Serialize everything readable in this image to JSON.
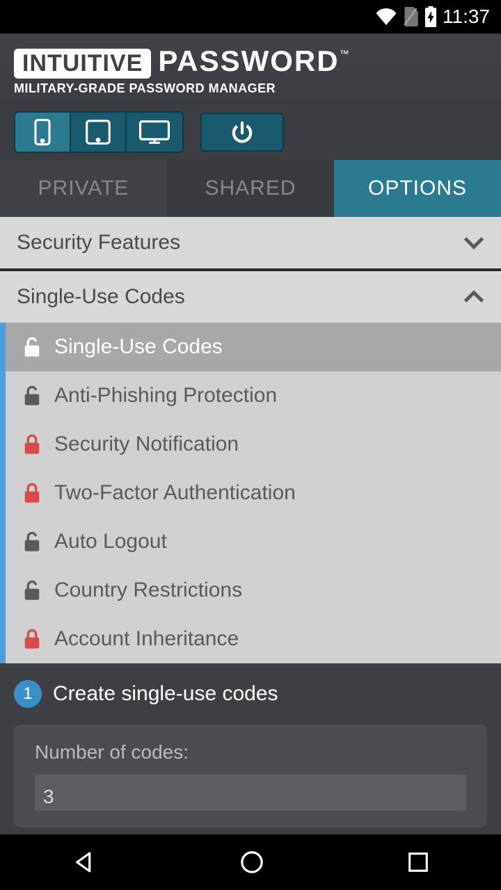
{
  "status": {
    "time": "11:37"
  },
  "brand": {
    "block": "INTUITIVE",
    "word": "PASSWORD",
    "tm": "™",
    "tagline": "MILITARY-GRADE PASSWORD MANAGER"
  },
  "tabs": {
    "private": "PRIVATE",
    "shared": "SHARED",
    "options": "OPTIONS"
  },
  "accordion": {
    "security_features": "Security Features",
    "single_use_codes": "Single-Use Codes",
    "items": [
      {
        "label": "Single-Use Codes",
        "locked": false,
        "selected": true
      },
      {
        "label": "Anti-Phishing Protection",
        "locked": false,
        "selected": false
      },
      {
        "label": "Security Notification",
        "locked": true,
        "selected": false
      },
      {
        "label": "Two-Factor Authentication",
        "locked": true,
        "selected": false
      },
      {
        "label": "Auto Logout",
        "locked": false,
        "selected": false
      },
      {
        "label": "Country Restrictions",
        "locked": false,
        "selected": false
      },
      {
        "label": "Account Inheritance",
        "locked": true,
        "selected": false
      }
    ]
  },
  "form": {
    "step_num": "1",
    "step_title": "Create single-use codes",
    "field_label": "Number of codes:",
    "field_value": "3"
  }
}
